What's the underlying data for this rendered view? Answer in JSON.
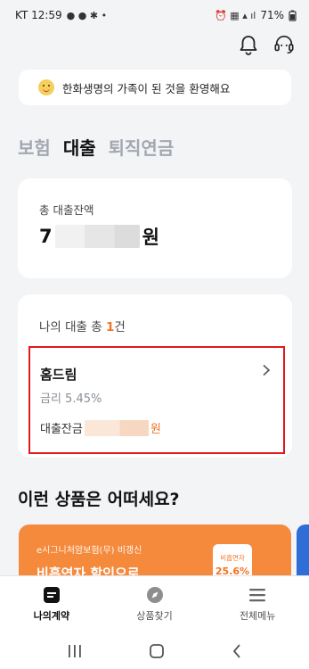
{
  "status": {
    "carrier_time": "KT 12:59",
    "battery": "71%"
  },
  "welcome": {
    "text": "한화생명의 가족이 된 것을 환영해요"
  },
  "tabs": [
    {
      "label": "보험"
    },
    {
      "label": "대출"
    },
    {
      "label": "퇴직연금"
    }
  ],
  "summary": {
    "label": "총 대출잔액",
    "amount_prefix": "7",
    "amount_suffix": "원"
  },
  "loans": {
    "count_prefix": "나의 대출 총 ",
    "count": "1",
    "count_suffix": "건",
    "item": {
      "name": "홈드림",
      "rate": "금리 5.45%",
      "balance_label": "대출잔금",
      "balance_unit": "원"
    }
  },
  "section": {
    "title": "이런 상품은 어떠세요?"
  },
  "promo": {
    "subtitle": "e시그니처암보험(무) 비갱신",
    "headline": "비흡연자 할인으로",
    "badge_label": "비흡연자",
    "badge_value": "25.6%"
  },
  "nav": [
    {
      "label": "나의계약"
    },
    {
      "label": "상품찾기"
    },
    {
      "label": "전체메뉴"
    }
  ],
  "colors": {
    "accent": "#f37321",
    "highlight_border": "#e1191e",
    "promo_bg": "#f58a3c"
  }
}
